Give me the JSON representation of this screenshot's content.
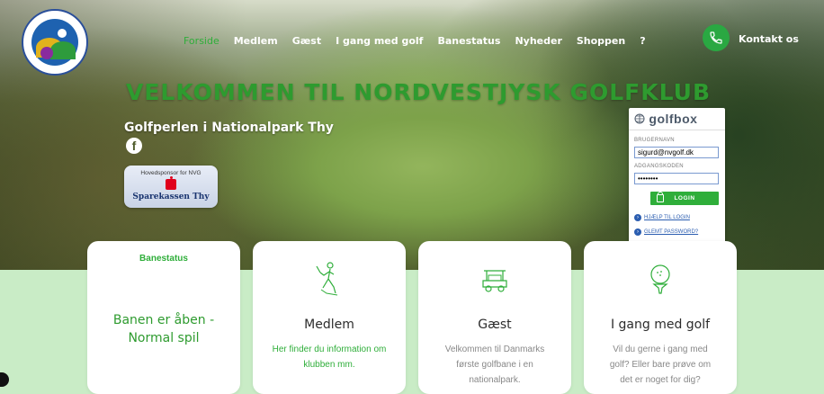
{
  "logo": {
    "alt": "Nordvestjysk Golfklub logo"
  },
  "nav": {
    "items": [
      "Forside",
      "Medlem",
      "Gæst",
      "I gang med golf",
      "Banestatus",
      "Nyheder",
      "Shoppen",
      "?"
    ],
    "active": "Forside",
    "contact_label": "Kontakt os"
  },
  "hero": {
    "headline": "VELKOMMEN TIL NORDVESTJYSK GOLFKLUB",
    "subtitle": "Golfperlen i Nationalpark Thy",
    "sponsor_label": "Hovedsponsor for NVG",
    "sponsor_name": "Sparekassen Thy"
  },
  "login": {
    "brand": "golfbox",
    "username_label": "BRUGERNAVN",
    "username_value": "sigurd@nvgolf.dk",
    "password_label": "ADGANGSKODEN",
    "password_value": "••••••••",
    "login_button": "LOGIN",
    "help_link": "HJÆLP TIL LOGIN",
    "forgot_link": "GLEMT PASSWORD?"
  },
  "cards": {
    "banestatus": {
      "label": "Banestatus",
      "status": "Banen er åben - Normal spil"
    },
    "medlem": {
      "title": "Medlem",
      "text": "Her finder du information om klubben mm."
    },
    "gaest": {
      "title": "Gæst",
      "text": "Velkommen til Danmarks første golfbane i en nationalpark."
    },
    "igang": {
      "title": "I gang med golf",
      "text": "Vil du gerne i gang med golf? Eller bare prøve om det er noget for dig?"
    }
  },
  "colors": {
    "accent_green": "#2fae3a",
    "page_bg": "#c9ecc6",
    "status_text": "#2e9b2f",
    "link_blue": "#2b5db0"
  },
  "icons": [
    "golfer-icon",
    "golf-cart-icon",
    "golf-ball-tee-icon",
    "phone-icon",
    "facebook-icon",
    "lock-icon"
  ]
}
